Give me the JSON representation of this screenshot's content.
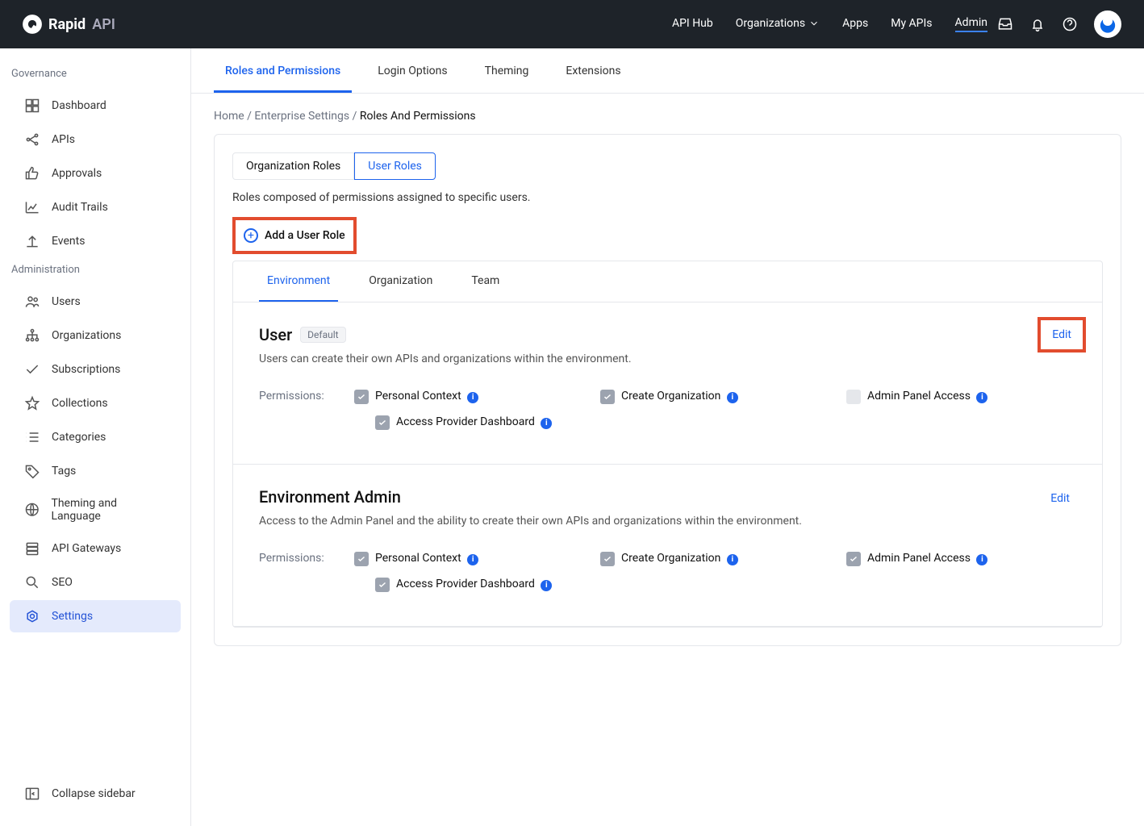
{
  "brand": {
    "name": "Rapid",
    "suffix": "API"
  },
  "topnav": {
    "items": [
      {
        "label": "API Hub",
        "dropdown": false,
        "active": false
      },
      {
        "label": "Organizations",
        "dropdown": true,
        "active": false
      },
      {
        "label": "Apps",
        "dropdown": false,
        "active": false
      },
      {
        "label": "My APIs",
        "dropdown": false,
        "active": false
      },
      {
        "label": "Admin",
        "dropdown": false,
        "active": true
      }
    ]
  },
  "sidebar": {
    "sections": [
      {
        "title": "Governance",
        "items": [
          {
            "label": "Dashboard",
            "icon": "dashboard-icon"
          },
          {
            "label": "APIs",
            "icon": "apis-icon"
          },
          {
            "label": "Approvals",
            "icon": "thumbs-up-icon"
          },
          {
            "label": "Audit Trails",
            "icon": "chart-line-icon"
          },
          {
            "label": "Events",
            "icon": "upload-icon"
          }
        ]
      },
      {
        "title": "Administration",
        "items": [
          {
            "label": "Users",
            "icon": "users-icon"
          },
          {
            "label": "Organizations",
            "icon": "hierarchy-icon"
          },
          {
            "label": "Subscriptions",
            "icon": "check-icon"
          },
          {
            "label": "Collections",
            "icon": "star-icon"
          },
          {
            "label": "Categories",
            "icon": "list-icon"
          },
          {
            "label": "Tags",
            "icon": "tag-icon"
          },
          {
            "label": "Theming and Language",
            "icon": "globe-icon"
          },
          {
            "label": "API Gateways",
            "icon": "stack-icon"
          },
          {
            "label": "SEO",
            "icon": "search-icon"
          },
          {
            "label": "Settings",
            "icon": "gear-icon",
            "active": true
          }
        ]
      }
    ],
    "footer": {
      "label": "Collapse sidebar",
      "icon": "collapse-icon"
    }
  },
  "mainTabs": [
    {
      "label": "Roles and Permissions",
      "active": true
    },
    {
      "label": "Login Options",
      "active": false
    },
    {
      "label": "Theming",
      "active": false
    },
    {
      "label": "Extensions",
      "active": false
    }
  ],
  "breadcrumb": {
    "items": [
      {
        "label": "Home",
        "link": true
      },
      {
        "label": "Enterprise Settings",
        "link": true
      },
      {
        "label": "Roles And Permissions",
        "link": false
      }
    ]
  },
  "roleTypeTabs": [
    {
      "label": "Organization Roles",
      "active": false
    },
    {
      "label": "User Roles",
      "active": true
    }
  ],
  "roleTypeDesc": "Roles composed of permissions assigned to specific users.",
  "addRole": {
    "label": "Add a User Role"
  },
  "scopeTabs": [
    {
      "label": "Environment",
      "active": true
    },
    {
      "label": "Organization",
      "active": false
    },
    {
      "label": "Team",
      "active": false
    }
  ],
  "roles": [
    {
      "title": "User",
      "badge": "Default",
      "desc": "Users can create their own APIs and organizations within the environment.",
      "editHighlight": true,
      "editLabel": "Edit",
      "permLabel": "Permissions:",
      "cols": [
        [
          {
            "label": "Personal Context",
            "checked": true,
            "info": true
          },
          {
            "label": "Access Provider Dashboard",
            "checked": true,
            "info": true,
            "sub": true
          }
        ],
        [
          {
            "label": "Create Organization",
            "checked": true,
            "info": true
          }
        ],
        [
          {
            "label": "Admin Panel Access",
            "checked": false,
            "info": true,
            "disabled": true
          }
        ]
      ]
    },
    {
      "title": "Environment Admin",
      "badge": "",
      "desc": "Access to the Admin Panel and the ability to create their own APIs and organizations within the environment.",
      "editHighlight": false,
      "editLabel": "Edit",
      "permLabel": "Permissions:",
      "cols": [
        [
          {
            "label": "Personal Context",
            "checked": true,
            "info": true
          },
          {
            "label": "Access Provider Dashboard",
            "checked": true,
            "info": true,
            "sub": true
          }
        ],
        [
          {
            "label": "Create Organization",
            "checked": true,
            "info": true
          }
        ],
        [
          {
            "label": "Admin Panel Access",
            "checked": true,
            "info": true
          }
        ]
      ]
    }
  ]
}
